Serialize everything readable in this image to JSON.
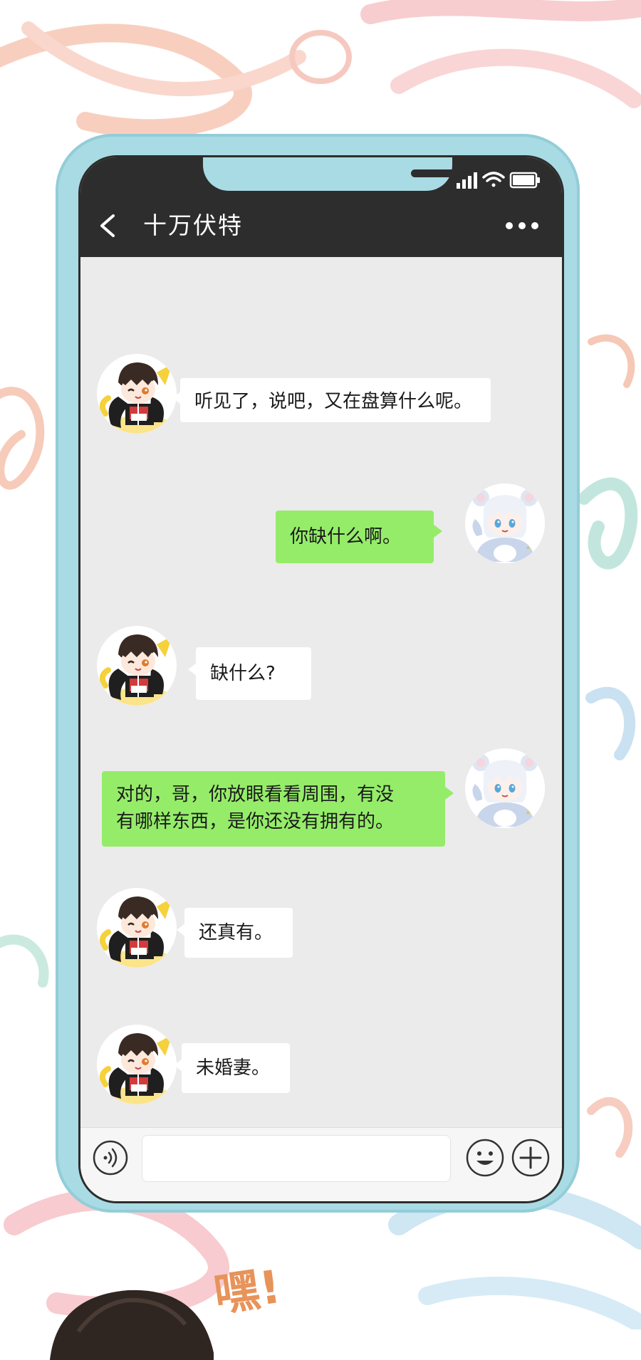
{
  "header": {
    "title": "十万伏特",
    "back_icon": "chevron-left-icon",
    "more_icon": "more-dots-icon"
  },
  "status_bar": {
    "icons": [
      "signal-icon",
      "wifi-icon",
      "battery-icon"
    ]
  },
  "messages": [
    {
      "side": "left",
      "avatar": "dark-hair-boy-avatar",
      "text": "听见了，说吧，又在盘算什么呢。"
    },
    {
      "side": "right",
      "avatar": "white-hair-boy-avatar",
      "text": "你缺什么啊。"
    },
    {
      "side": "left",
      "avatar": "dark-hair-boy-avatar",
      "text": "缺什么?"
    },
    {
      "side": "right",
      "avatar": "white-hair-boy-avatar",
      "line1": "对的，哥，你放眼看看周围，有没",
      "line2": "有哪样东西，是你还没有拥有的。"
    },
    {
      "side": "left",
      "avatar": "dark-hair-boy-avatar",
      "text": "还真有。"
    },
    {
      "side": "left",
      "avatar": "dark-hair-boy-avatar",
      "text": "未婚妻。"
    }
  ],
  "input_bar": {
    "value": "",
    "voice_icon": "voice-icon",
    "emoji_icon": "emoji-icon",
    "plus_icon": "plus-icon"
  },
  "decor": {
    "exclamation": "嘿!"
  },
  "colors": {
    "phone_case": "#a9dbe4",
    "header_bg": "#2d2d2d",
    "chat_bg": "#ebebeb",
    "bubble_sent": "#95ec69",
    "bubble_received": "#ffffff"
  }
}
